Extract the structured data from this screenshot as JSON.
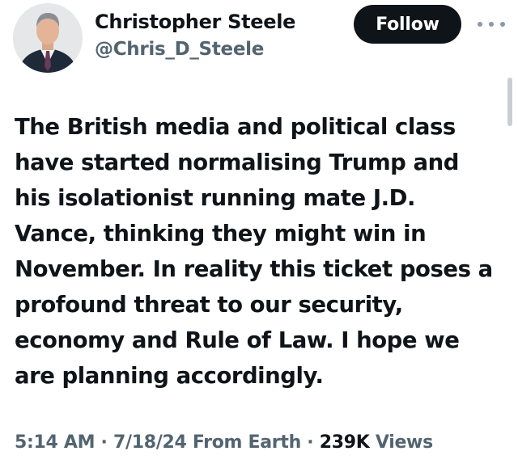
{
  "author": {
    "name": "Christopher Steele",
    "handle": "@Chris_D_Steele"
  },
  "follow_button": {
    "label": "Follow"
  },
  "more_icon": "more-horizontal-icon",
  "tweet": {
    "lines": [
      "The British media and political class",
      "have started normalising Trump and",
      "his isolationist running mate J.D.",
      "Vance, thinking they might win in",
      "November. In reality this ticket poses a",
      "profound threat to our security,",
      "economy and Rule of Law. I hope we",
      "are planning accordingly."
    ]
  },
  "meta": {
    "time": "5:14 AM",
    "separator": " · ",
    "date": "7/18/24",
    "source": " From Earth",
    "views_count": "239K",
    "views_label": " Views"
  },
  "colors": {
    "text": "#0f1419",
    "secondary": "#536471",
    "button_bg": "#0f1419"
  }
}
